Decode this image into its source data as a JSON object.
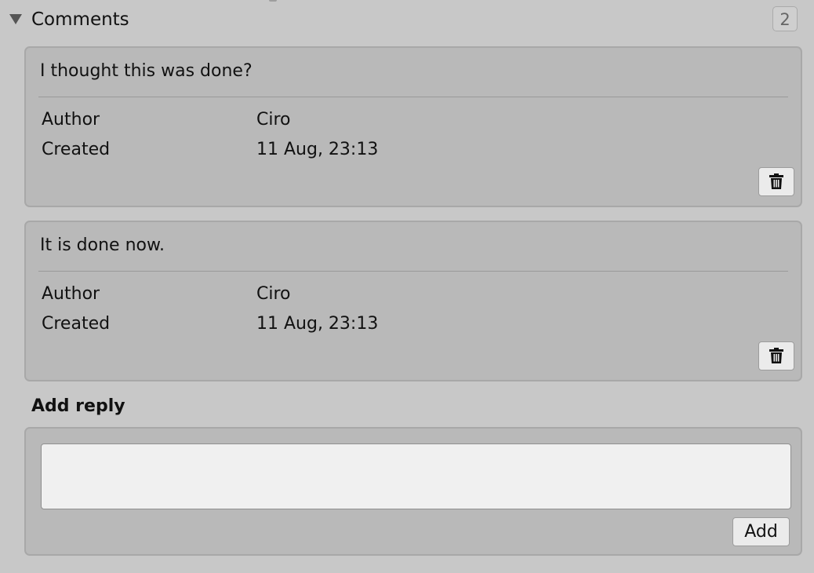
{
  "section": {
    "title": "Comments",
    "count": "2"
  },
  "comments": [
    {
      "text": "I thought this was done?",
      "author_label": "Author",
      "author": "Ciro",
      "created_label": "Created",
      "created": "11 Aug, 23:13"
    },
    {
      "text": "It is done now.",
      "author_label": "Author",
      "author": "Ciro",
      "created_label": "Created",
      "created": "11 Aug, 23:13"
    }
  ],
  "reply": {
    "heading": "Add reply",
    "input_value": "",
    "add_label": "Add"
  },
  "icons": {
    "foldout": "triangle-down-icon",
    "delete": "trash-icon"
  },
  "colors": {
    "panel_background": "#c8c8c8",
    "card_background": "#b9b9b9",
    "input_background": "#f0f0f0",
    "button_background": "#ebebeb"
  }
}
